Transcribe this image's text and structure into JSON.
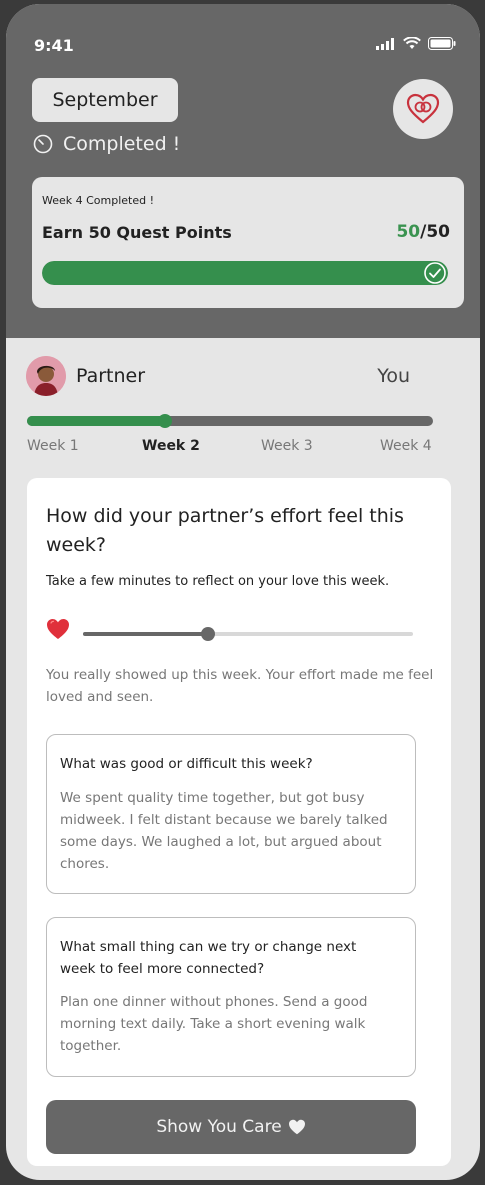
{
  "status": {
    "time": "9:41"
  },
  "header": {
    "month": "September",
    "completed": "Completed !"
  },
  "quest": {
    "subtitle": "Week 4 Completed !",
    "title": "Earn 50 Quest Points",
    "earned": "50",
    "total": "/50",
    "progress": 1.0
  },
  "partner": {
    "name": "Partner",
    "you": "You"
  },
  "weeks": {
    "labels": [
      "Week 1",
      "Week 2",
      "Week 3",
      "Week 4"
    ],
    "active_index": 1
  },
  "reflection": {
    "question": "How did your partner’s effort feel this week?",
    "subtitle": "Take a few minutes to reflect on your love this week.",
    "slider_value": 0.38,
    "feedback": "You really showed up this week. Your effort made me feel loved and seen."
  },
  "prompts": [
    {
      "question": "What was good or difficult this week?",
      "answer": "We spent quality time together, but got busy midweek. I felt distant because we barely talked some days. We laughed a lot, but argued about chores."
    },
    {
      "question": "What small thing can we try or change next week to feel more connected?",
      "answer": "Plan one dinner without phones. Send a good morning text daily. Take a short evening walk together."
    }
  ],
  "cta": {
    "label": "Show You Care",
    "icon": "white-heart-icon"
  },
  "colors": {
    "green": "#358f4d",
    "dark": "#676767",
    "accent_red": "#c8323d"
  }
}
